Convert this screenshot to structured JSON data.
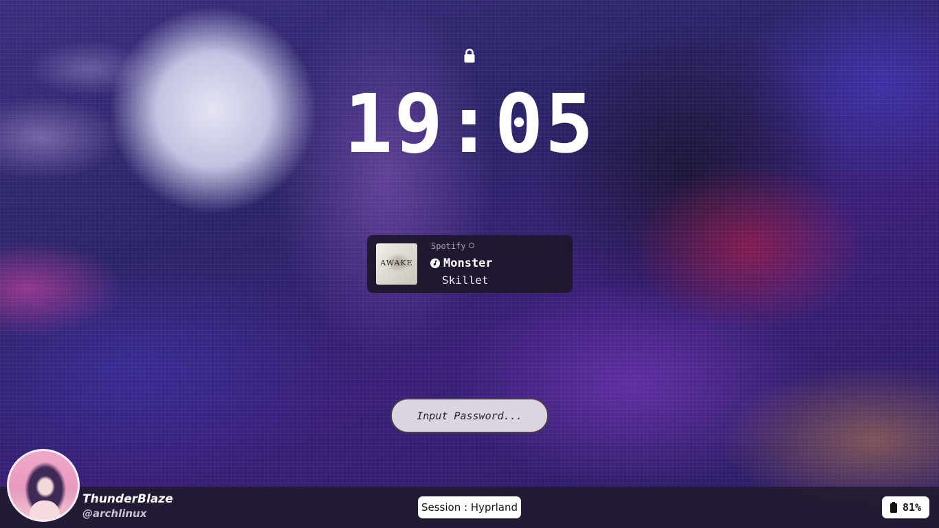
{
  "lock_screen": {
    "lock_icon": "lock-icon",
    "clock": "19:05"
  },
  "media": {
    "source": "Spotify",
    "title_icon": "music-note-icon",
    "title": "Monster",
    "artist": "Skillet",
    "album_art_text": "AWAKE"
  },
  "password": {
    "placeholder": "Input Password..."
  },
  "user": {
    "name": "ThunderBlaze",
    "handle": "@archlinux"
  },
  "session": {
    "label": "Session : Hyprland"
  },
  "battery": {
    "icon": "battery-icon",
    "level": "81%"
  }
}
